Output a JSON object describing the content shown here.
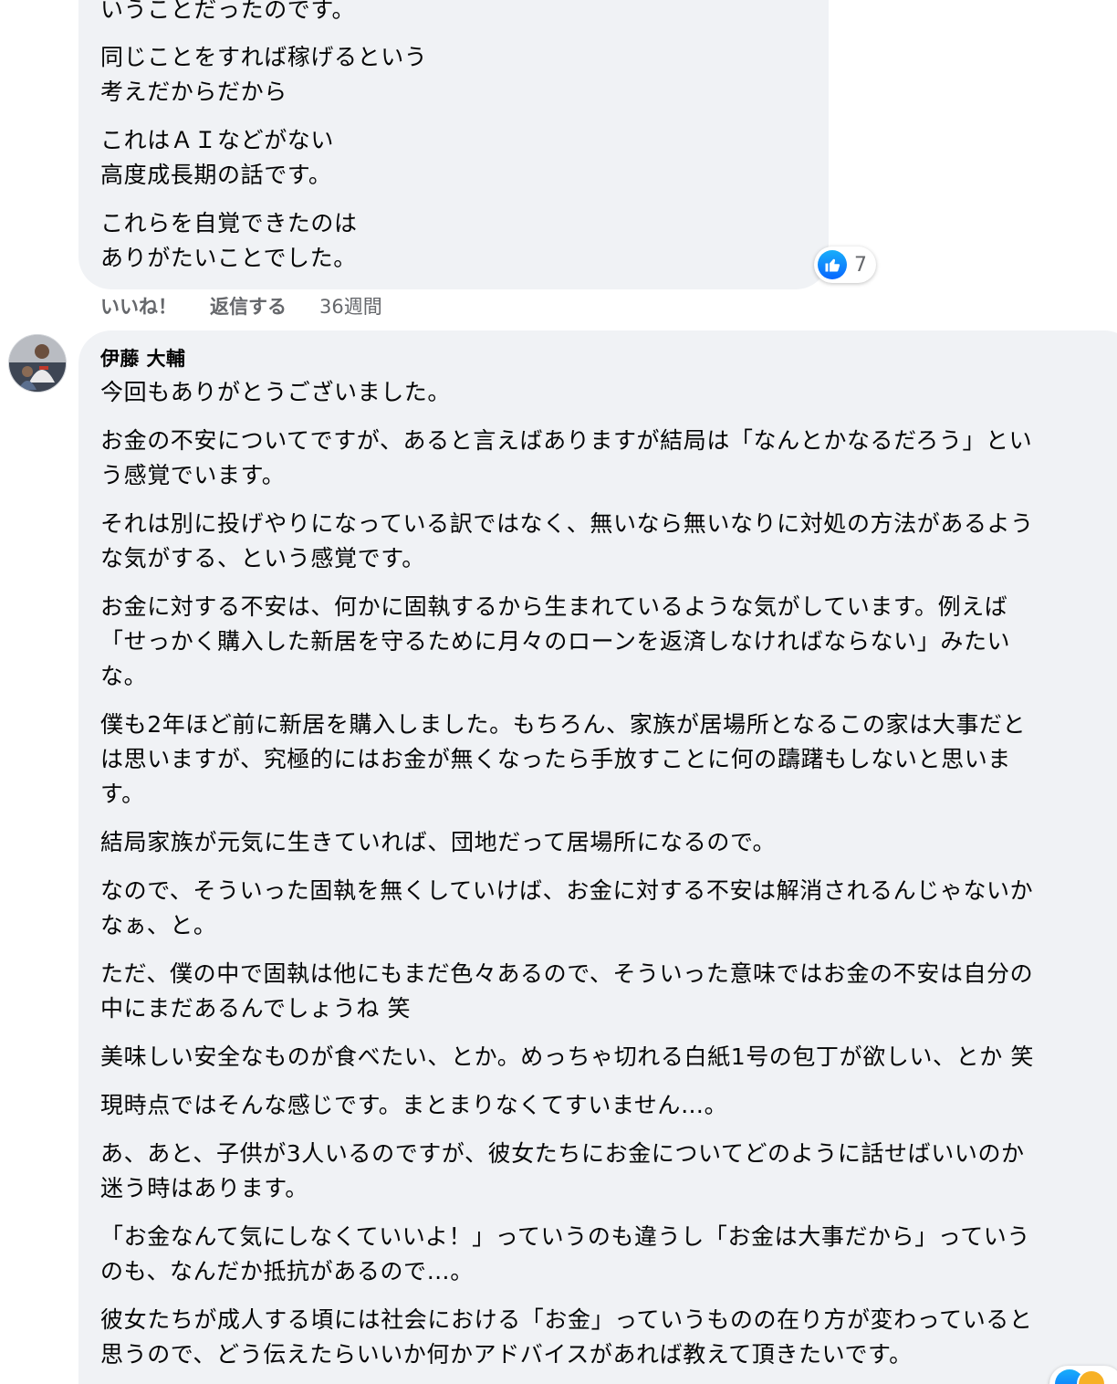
{
  "comment_1": {
    "paragraphs": [
      [
        "いうことだったのです。"
      ],
      [
        "同じことをすれば稼げるという",
        "考えだからだから"
      ],
      [
        "これはＡＩなどがない",
        "高度成長期の話です。"
      ],
      [
        "これらを自覚できたのは",
        "ありがたいことでした。"
      ]
    ],
    "reaction_count": "7",
    "actions": {
      "like": "いいね！",
      "reply": "返信する",
      "time": "36週間"
    }
  },
  "comment_2": {
    "author": "伊藤 大輔",
    "paragraphs": [
      [
        "今回もありがとうございました。"
      ],
      [
        "お金の不安についてですが、あると言えばありますが結局は「なんとかなるだろう」とい",
        "う感覚でいます。"
      ],
      [
        "それは別に投げやりになっている訳ではなく、無いなら無いなりに対処の方法があるよう",
        "な気がする、という感覚です。"
      ],
      [
        "お金に対する不安は、何かに固執するから生まれているような気がしています。例えば",
        "「せっかく購入した新居を守るために月々のローンを返済しなければならない」みたい",
        "な。"
      ],
      [
        "僕も2年ほど前に新居を購入しました。もちろん、家族が居場所となるこの家は大事だと",
        "は思いますが、究極的にはお金が無くなったら手放すことに何の躊躇もしないと思いま",
        "す。"
      ],
      [
        "結局家族が元気に生きていれば、団地だって居場所になるので。"
      ],
      [
        "なので、そういった固執を無くしていけば、お金に対する不安は解消されるんじゃないか",
        "なぁ、と。"
      ],
      [
        "ただ、僕の中で固執は他にもまだ色々あるので、そういった意味ではお金の不安は自分の",
        "中にまだあるんでしょうね 笑"
      ],
      [
        "美味しい安全なものが食べたい、とか。めっちゃ切れる白紙1号の包丁が欲しい、とか 笑"
      ],
      [
        "現時点ではそんな感じです。まとまりなくてすいません…。"
      ],
      [
        "あ、あと、子供が3人いるのですが、彼女たちにお金についてどのように話せばいいのか",
        "迷う時はあります。"
      ],
      [
        "「お金なんて気にしなくていいよ！」っていうのも違うし「お金は大事だから」っていう",
        "のも、なんだか抵抗があるので…。"
      ],
      [
        "彼女たちが成人する頃には社会における「お金」っていうものの在り方が変わっていると",
        "思うので、どう伝えたらいいか何かアドバイスがあれば教えて頂きたいです。"
      ]
    ]
  },
  "icons": {
    "reaction_like": "thumbs-up-icon",
    "reaction_wow": "wow-face-icon",
    "avatar": "user-avatar"
  },
  "colors": {
    "bubble_bg": "#f0f2f5",
    "meta_text": "#65676b",
    "like_blue": "#0866ff"
  }
}
